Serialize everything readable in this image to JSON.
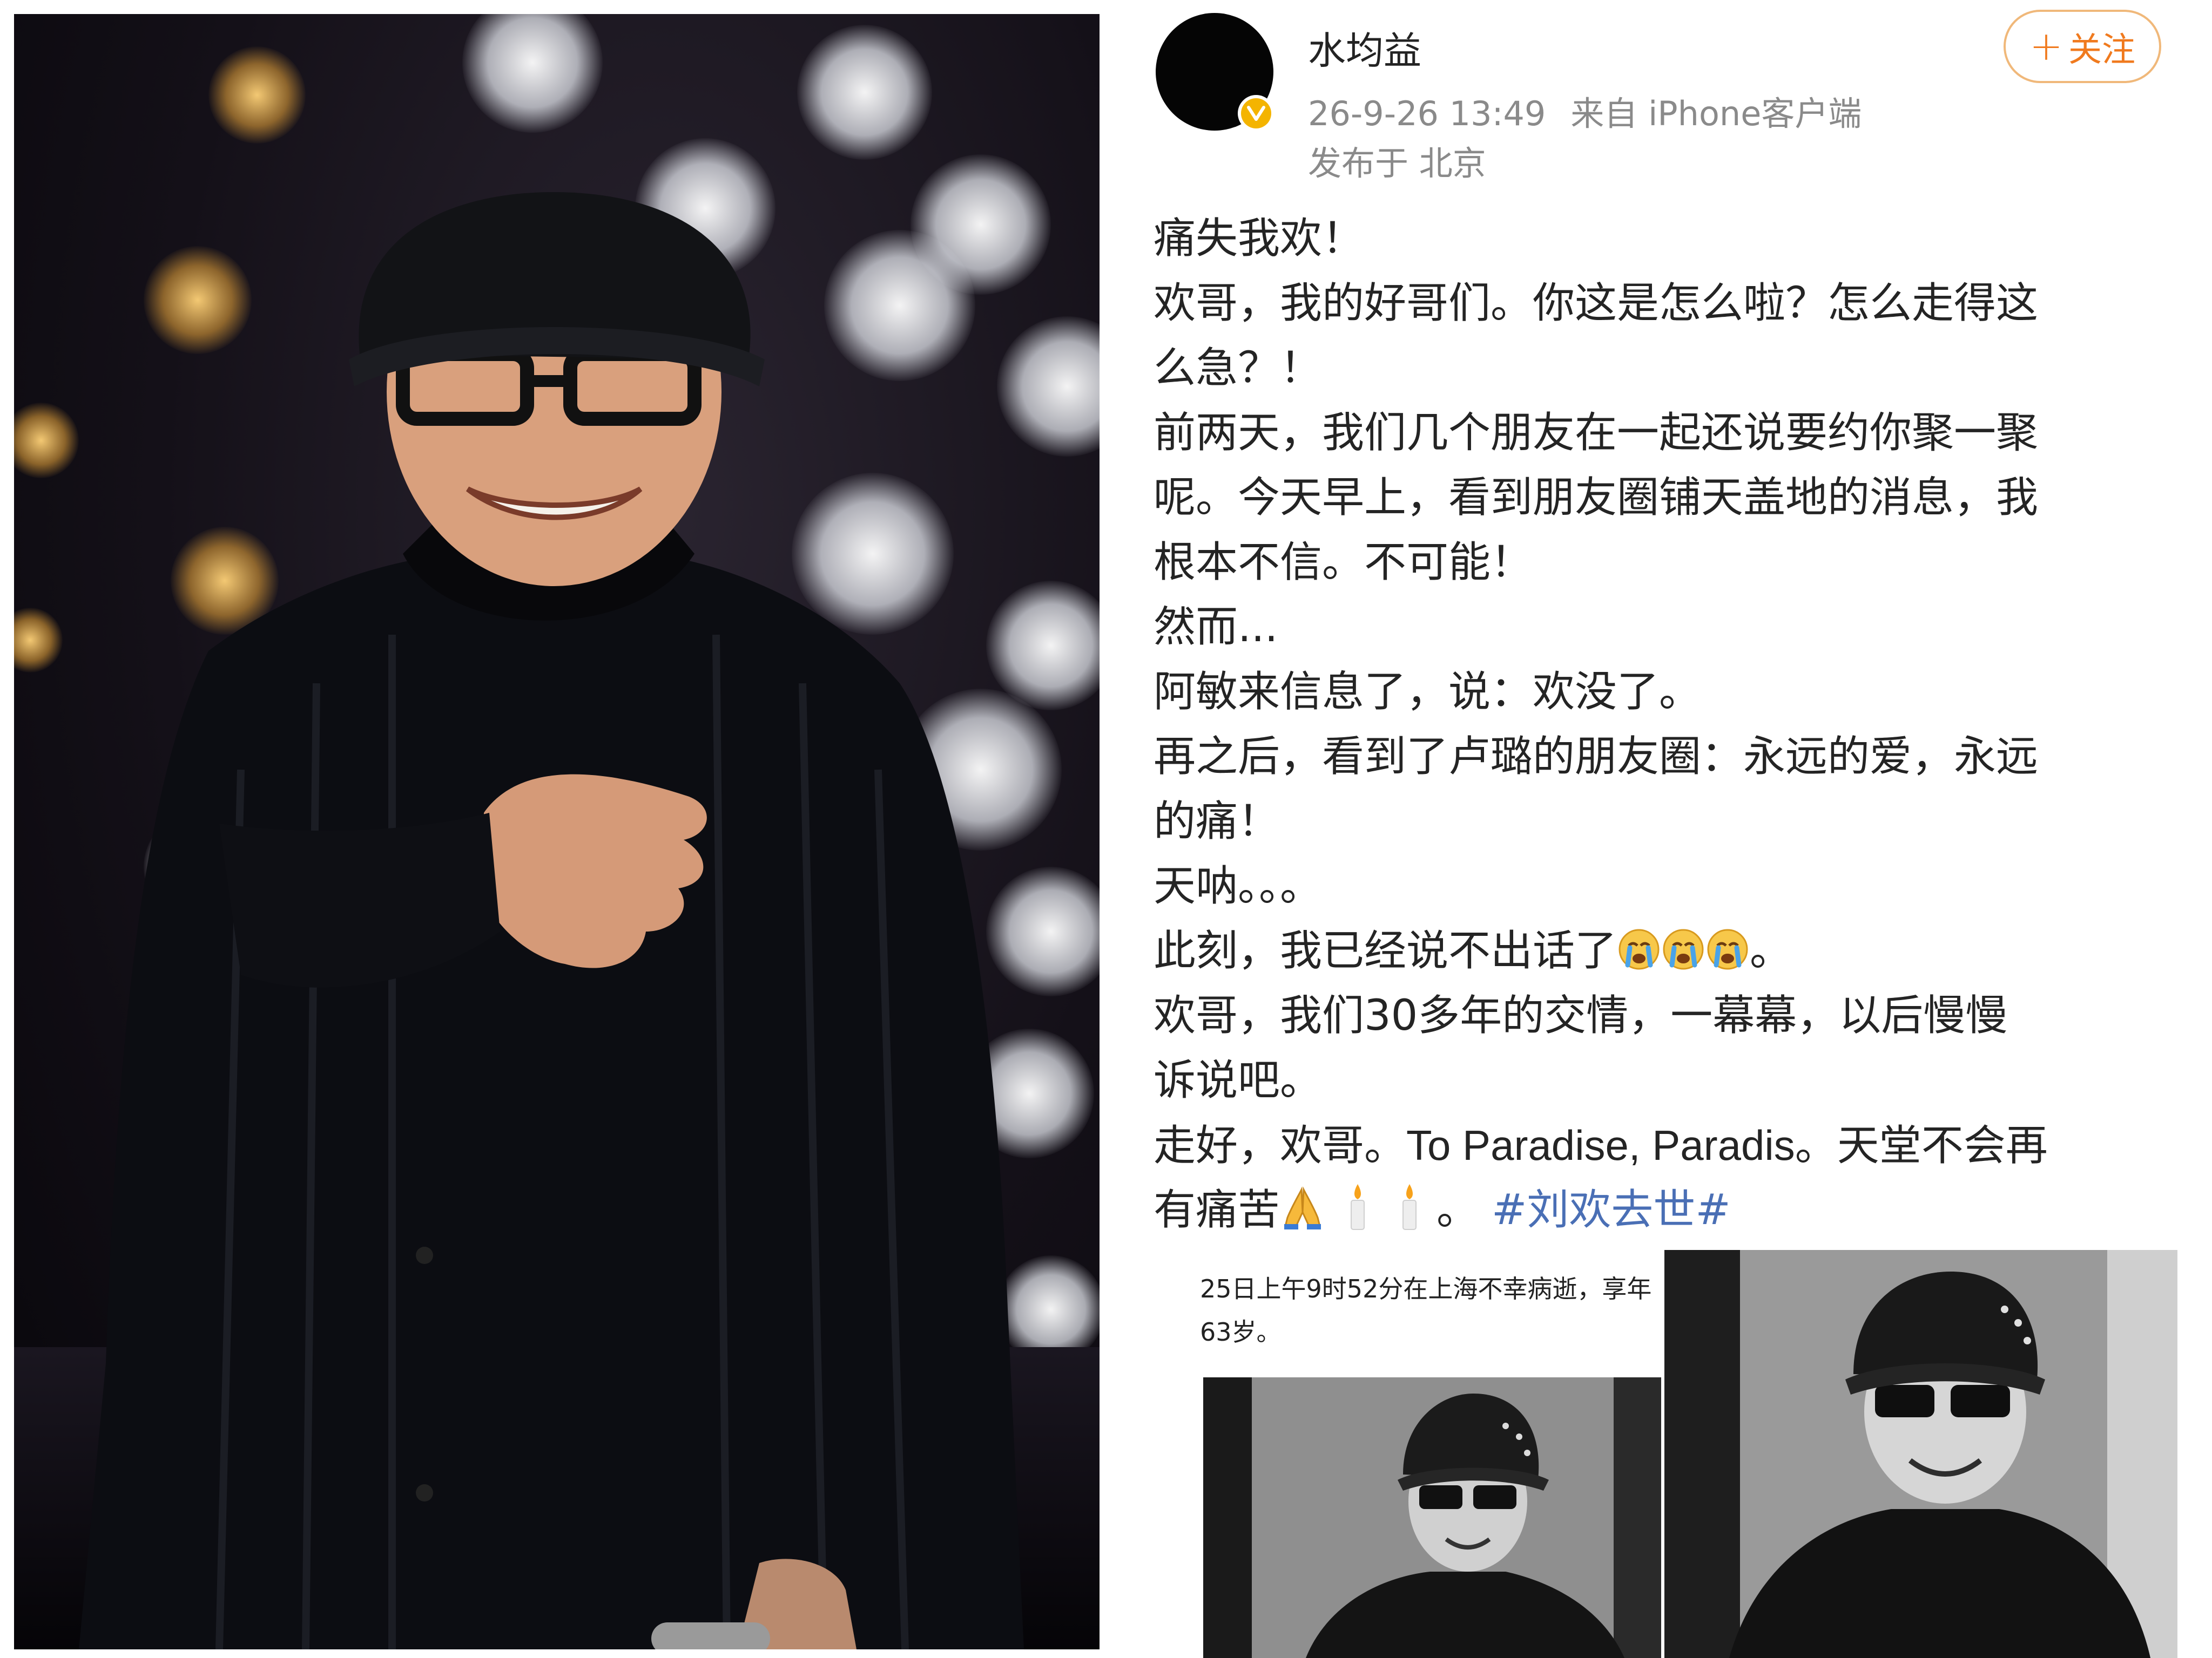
{
  "post": {
    "username": "水均益",
    "timestamp": "26-9-26 13:49",
    "source": "来自 iPhone客户端",
    "location": "发布于 北京",
    "follow_label": "关注",
    "follow_plus": "+",
    "body_lines": [
      "痛失我欢！",
      "欢哥，我的好哥们。你这是怎么啦？怎么走得这",
      "么急？！",
      "前两天，我们几个朋友在一起还说要约你聚一聚",
      "呢。今天早上，看到朋友圈铺天盖地的消息，我",
      "根本不信。不可能！",
      "然而...",
      "阿敏来信息了，说：欢没了。",
      "再之后，看到了卢璐的朋友圈：永远的爱，永远",
      "的痛！",
      "天呐。。。"
    ],
    "line_12_text": "此刻，我已经说不出话了",
    "line_12_end": "。",
    "line_13": "欢哥，我们30多年的交情，一幕幕，以后慢慢",
    "line_14": "诉说吧。",
    "line_15": "走好，欢哥。To Paradise, Paradis。天堂不会再",
    "line_16_text": "有痛苦",
    "line_16_end": "。",
    "hashtag": "#刘欢去世#"
  },
  "attachment": {
    "caption": "25日上午9时52分在上海不幸病逝，享年63岁。"
  },
  "icons": {
    "verified": "verified-badge-icon",
    "crying": "crying-face-icon",
    "pray": "folded-hands-icon",
    "candle": "candle-icon"
  },
  "colors": {
    "follow_accent": "#f07a1e",
    "hashtag": "#4a6fb5",
    "meta_gray": "#8a8a8a",
    "verified_gold": "#f4b400"
  }
}
